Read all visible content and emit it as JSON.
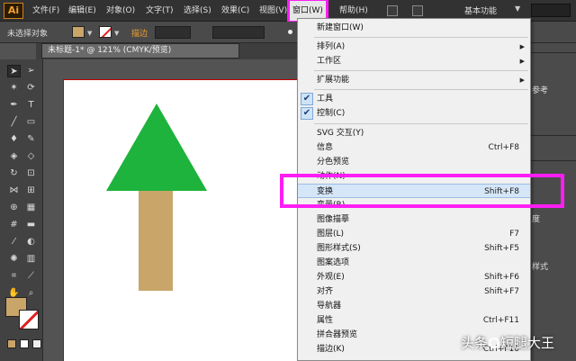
{
  "app": {
    "logo": "Ai"
  },
  "menubar": {
    "items": [
      {
        "label": "文件(F)"
      },
      {
        "label": "编辑(E)"
      },
      {
        "label": "对象(O)"
      },
      {
        "label": "文字(T)"
      },
      {
        "label": "选择(S)"
      },
      {
        "label": "效果(C)"
      },
      {
        "label": "视图(V)"
      },
      {
        "label": "窗口(W)"
      },
      {
        "label": "帮助(H)"
      }
    ],
    "workspace": "基本功能"
  },
  "control_bar": {
    "selection_status": "未选择对象",
    "stroke_label": "描边",
    "fill_color": "#c9a56a",
    "stroke_color": "#ffffff"
  },
  "document_tab": {
    "title": "未标题-1* @ 121% (CMYK/预览)"
  },
  "window_menu": {
    "items": [
      {
        "label": "新建窗口(W)",
        "shortcut": ""
      },
      {
        "label": "排列(A)",
        "shortcut": "",
        "submenu": true
      },
      {
        "label": "工作区",
        "shortcut": "",
        "submenu": true
      },
      {
        "label": "扩展功能",
        "shortcut": "",
        "submenu": true
      },
      {
        "label": "工具",
        "shortcut": "",
        "checked": true
      },
      {
        "label": "控制(C)",
        "shortcut": "",
        "checked": true
      },
      {
        "label": "SVG 交互(Y)",
        "shortcut": ""
      },
      {
        "label": "信息",
        "shortcut": "Ctrl+F8"
      },
      {
        "label": "分色预览",
        "shortcut": ""
      },
      {
        "label": "动作(N)",
        "shortcut": ""
      },
      {
        "label": "变换",
        "shortcut": "Shift+F8"
      },
      {
        "label": "变量(R)",
        "shortcut": ""
      },
      {
        "label": "图像描摹",
        "shortcut": ""
      },
      {
        "label": "图层(L)",
        "shortcut": "F7"
      },
      {
        "label": "图形样式(S)",
        "shortcut": "Shift+F5"
      },
      {
        "label": "图案选项",
        "shortcut": ""
      },
      {
        "label": "外观(E)",
        "shortcut": "Shift+F6"
      },
      {
        "label": "对齐",
        "shortcut": "Shift+F7"
      },
      {
        "label": "导航器",
        "shortcut": ""
      },
      {
        "label": "属性",
        "shortcut": "Ctrl+F11"
      },
      {
        "label": "拼合器预览",
        "shortcut": ""
      },
      {
        "label": "描边(K)",
        "shortcut": "Ctrl+F10"
      }
    ]
  },
  "panels": {
    "labels": [
      "参考",
      "度",
      "样式"
    ]
  },
  "canvas": {
    "tree_top_color": "#1db33c",
    "tree_trunk_color": "#c9a56a"
  },
  "watermark": {
    "prefix": "头条",
    "author": "短腿大王"
  },
  "highlight_color": "#ff1df5"
}
